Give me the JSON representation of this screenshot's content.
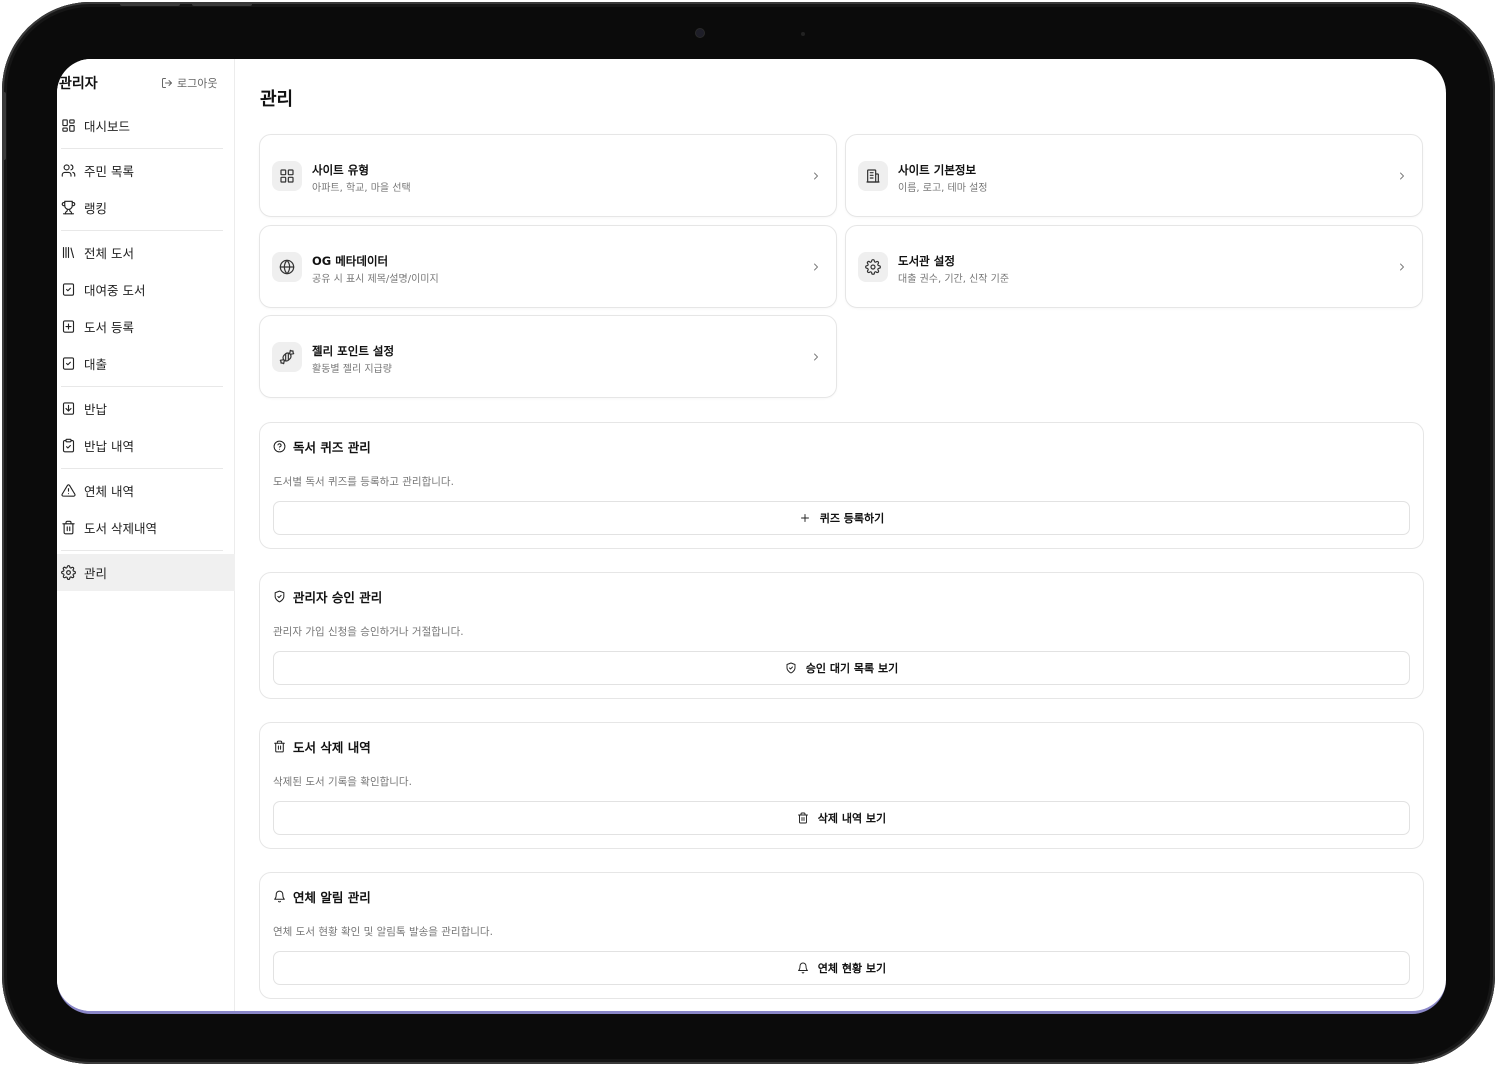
{
  "sidebar": {
    "title": "관리자",
    "logout_label": "로그아웃",
    "items": [
      {
        "label": "대시보드",
        "icon": "dashboard-icon"
      },
      {
        "label": "주민 목록",
        "icon": "users-icon"
      },
      {
        "label": "랭킹",
        "icon": "trophy-icon"
      },
      {
        "label": "전체 도서",
        "icon": "library-icon"
      },
      {
        "label": "대여중 도서",
        "icon": "book-check-icon"
      },
      {
        "label": "도서 등록",
        "icon": "book-plus-icon"
      },
      {
        "label": "대출",
        "icon": "book-check-icon"
      },
      {
        "label": "반납",
        "icon": "book-down-icon"
      },
      {
        "label": "반납 내역",
        "icon": "clipboard-check-icon"
      },
      {
        "label": "연체 내역",
        "icon": "alert-triangle-icon"
      },
      {
        "label": "도서 삭제내역",
        "icon": "trash-icon"
      },
      {
        "label": "관리",
        "icon": "gear-icon"
      }
    ]
  },
  "main": {
    "title": "관리",
    "cards": [
      {
        "title": "사이트 유형",
        "subtitle": "아파트, 학교, 마을 선택",
        "icon": "grid-icon"
      },
      {
        "title": "사이트 기본정보",
        "subtitle": "이름, 로고, 테마 설정",
        "icon": "building-icon"
      },
      {
        "title": "OG 메타데이터",
        "subtitle": "공유 시 표시 제목/설명/이미지",
        "icon": "globe-icon"
      },
      {
        "title": "도서관 설정",
        "subtitle": "대출 권수, 기간, 신작 기준",
        "icon": "gear-icon"
      },
      {
        "title": "젤리 포인트 설정",
        "subtitle": "활동별 젤리 지급량",
        "icon": "candy-icon"
      }
    ],
    "sections": [
      {
        "title": "독서 퀴즈 관리",
        "description": "도서별 독서 퀴즈를 등록하고 관리합니다.",
        "button": "퀴즈 등록하기",
        "icon": "help-circle-icon",
        "button_icon": "plus-icon"
      },
      {
        "title": "관리자 승인 관리",
        "description": "관리자 가입 신청을 승인하거나 거절합니다.",
        "button": "승인 대기 목록 보기",
        "icon": "shield-check-icon",
        "button_icon": "shield-check-icon"
      },
      {
        "title": "도서 삭제 내역",
        "description": "삭제된 도서 기록을 확인합니다.",
        "button": "삭제 내역 보기",
        "icon": "trash-icon",
        "button_icon": "trash-icon"
      },
      {
        "title": "연체 알림 관리",
        "description": "연체 도서 현황 확인 및 알림톡 발송을 관리합니다.",
        "button": "연체 현황 보기",
        "icon": "bell-icon",
        "button_icon": "bell-icon"
      }
    ]
  },
  "colors": {
    "active_bg": "#f0f0f0",
    "border": "#e6e6e6",
    "icon_bg": "#efefef",
    "muted_text": "#777777",
    "bezel": "#0b0b0b"
  }
}
